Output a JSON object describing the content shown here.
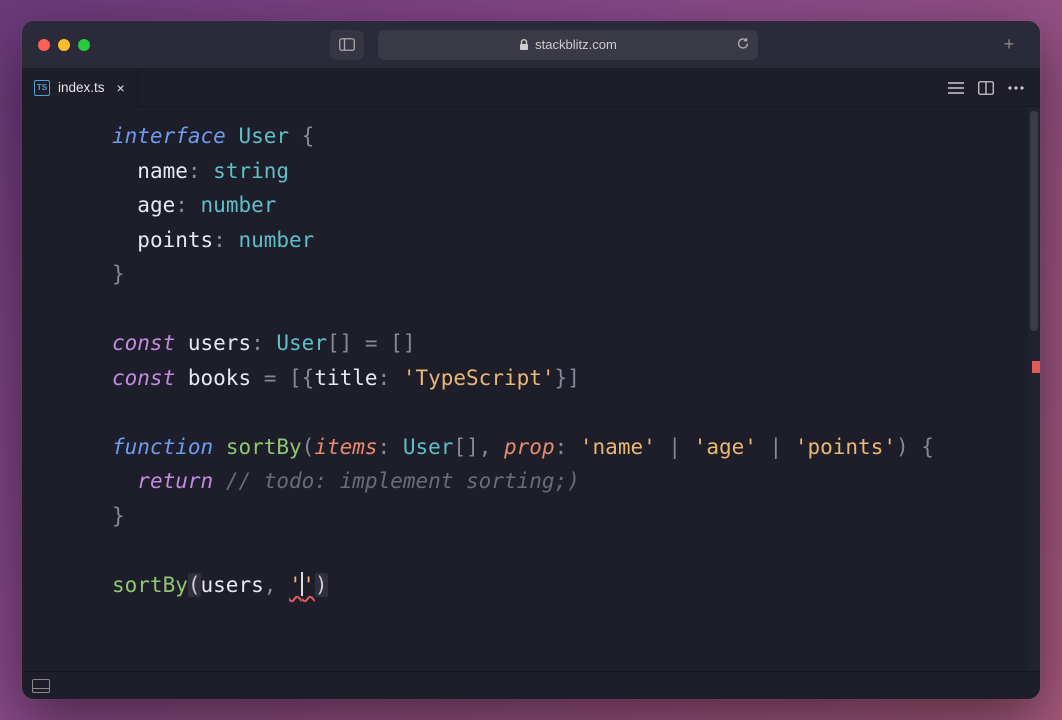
{
  "browser": {
    "host": "stackblitz.com",
    "newtab": "+"
  },
  "tab": {
    "icon_label": "TS",
    "filename": "index.ts",
    "close": "×"
  },
  "code": {
    "l1_kw": "interface",
    "l1_name": "User",
    "l1_brace": " {",
    "l2_prop": "name",
    "l2_type": "string",
    "l3_prop": "age",
    "l3_type": "number",
    "l4_prop": "points",
    "l4_type": "number",
    "l5_brace": "}",
    "l7_kw": "const",
    "l7_var": "users",
    "l7_type": "User",
    "l7_rest": "[] = []",
    "l8_kw": "const",
    "l8_var": "books",
    "l8_eq": " = [{",
    "l8_key": "title",
    "l8_colon": ": ",
    "l8_str": "'TypeScript'",
    "l8_close": "}]",
    "l10_kw": "function",
    "l10_fn": "sortBy",
    "l10_p1": "items",
    "l10_p1t": "User",
    "l10_arr": "[]",
    "l10_p2": "prop",
    "l10_s1": "'name'",
    "l10_s2": "'age'",
    "l10_s3": "'points'",
    "l10_end": ") {",
    "l11_kw": "return",
    "l11_comment": "// todo: implement sorting;)",
    "l12_brace": "}",
    "l14_fn": "sortBy",
    "l14_arg": "users",
    "l14_str": "''"
  }
}
